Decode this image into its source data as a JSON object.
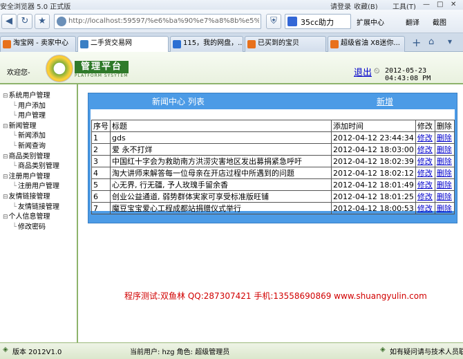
{
  "browser": {
    "window_title": "安全浏览器 5.0 正式版",
    "login_label": "请登录",
    "favorites_label": "收藏(B)",
    "tools_label": "工具(T)",
    "address": "http://localhost:59597/%e6%ba%90%e7%a8%8b%e5%",
    "search_label": "35cc助力",
    "extensions_label": "扩展中心",
    "translate_label": "翻译",
    "screenshot_label": "截图",
    "tabs": [
      {
        "label": "淘宝网 - 卖家中心",
        "color": "#e8711c"
      },
      {
        "label": "二手货交易网",
        "color": "#3a7fc4"
      },
      {
        "label": "115，我的网盘，...",
        "color": "#2b6fd3"
      },
      {
        "label": "已买到的宝贝",
        "color": "#e8711c"
      },
      {
        "label": "超级省油 X8迷你...",
        "color": "#e8711c"
      }
    ]
  },
  "app": {
    "welcome": "欢迎您-",
    "logo_text": "管理平台",
    "logo_subtext": "PLATFORM SYSYTEM",
    "logout": "退出",
    "datetime": "2012-05-23 04:43:08 PM"
  },
  "sidebar": {
    "items": [
      {
        "label": "系统用户管理",
        "level": 0
      },
      {
        "label": "用户添加",
        "level": 1
      },
      {
        "label": "用户管理",
        "level": 1
      },
      {
        "label": "新闻管理",
        "level": 0
      },
      {
        "label": "新闻添加",
        "level": 1
      },
      {
        "label": "新闻查询",
        "level": 1
      },
      {
        "label": "商品类别管理",
        "level": 0
      },
      {
        "label": "商品类别管理",
        "level": 1
      },
      {
        "label": "注册用户管理",
        "level": 0
      },
      {
        "label": "注册用户管理",
        "level": 1
      },
      {
        "label": "友情链接管理",
        "level": 0
      },
      {
        "label": "友情链接管理",
        "level": 1
      },
      {
        "label": "个人信息管理",
        "level": 0
      },
      {
        "label": "修改密码",
        "level": 1
      }
    ]
  },
  "news": {
    "panel_title": "新闻中心 列表",
    "add_label": "新增",
    "columns": [
      "序号",
      "标题",
      "添加时间",
      "修改",
      "删除"
    ],
    "rows": [
      {
        "no": "1",
        "title": "gds",
        "time": "2012-04-12 23:44:34",
        "edit": "修改",
        "del": "删除"
      },
      {
        "no": "2",
        "title": "爱 永不打烊",
        "time": "2012-04-12 18:03:00",
        "edit": "修改",
        "del": "删除"
      },
      {
        "no": "3",
        "title": "中国红十字会为救助南方洪涝灾害地区发出募捐紧急呼吁",
        "time": "2012-04-12 18:02:39",
        "edit": "修改",
        "del": "删除"
      },
      {
        "no": "4",
        "title": "淘大讲师来解答每一位母亲在开店过程中所遇到的问题",
        "time": "2012-04-12 18:02:12",
        "edit": "修改",
        "del": "删除"
      },
      {
        "no": "5",
        "title": "心无界, 行无疆, 予人玫瑰手留余香",
        "time": "2012-04-12 18:01:49",
        "edit": "修改",
        "del": "删除"
      },
      {
        "no": "6",
        "title": "创业公益通道, 弱势群体実家可享受标准版旺铺",
        "time": "2012-04-12 18:01:25",
        "edit": "修改",
        "del": "删除"
      },
      {
        "no": "7",
        "title": "魔豆宝宝爱心工程成都站捐赠仪式举行",
        "time": "2012-04-12 18:00:53",
        "edit": "修改",
        "del": "删除"
      }
    ]
  },
  "credit": "程序测试:双鱼林 QQ:287307421 手机:13558690869 www.shuangyulin.com",
  "status": {
    "version": "版本 2012V1.0",
    "current_user": "当前用户: hzg 角色: 超级管理员",
    "help": "如有疑问请与技术人员联系"
  }
}
